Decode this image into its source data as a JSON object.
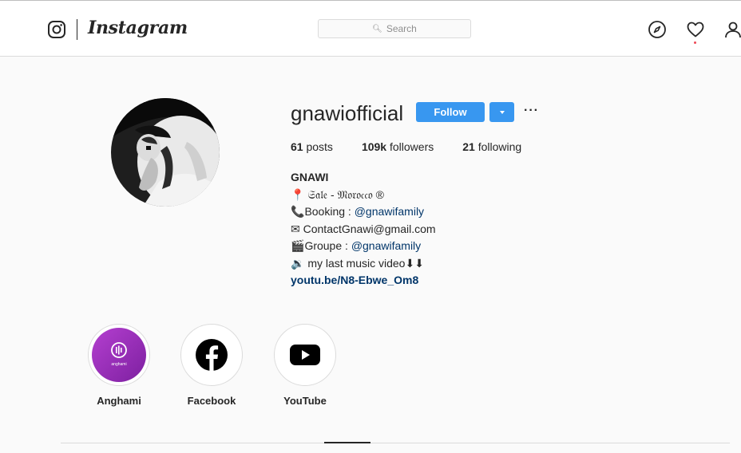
{
  "header": {
    "wordmark": "Instagram",
    "search_placeholder": "Search",
    "icons": [
      "instagram-glyph-icon",
      "compass-icon",
      "heart-icon",
      "profile-icon"
    ]
  },
  "profile": {
    "username": "gnawiofficial",
    "follow_label": "Follow",
    "stats": {
      "posts_count": "61",
      "posts_label": "posts",
      "followers_count": "109k",
      "followers_label": "followers",
      "following_count": "21",
      "following_label": "following"
    },
    "bio": {
      "name": "GNAWI",
      "location_emoji": "📍",
      "location_text": "𝔖𝔞𝔩𝔢 - 𝔐𝔬𝔯𝔬𝔠𝔠𝔬 ®",
      "booking_emoji": "📞",
      "booking_text": "Booking : ",
      "booking_mention": "@gnawifamily",
      "email_emoji": "✉",
      "email_text": "ContactGnawi@gmail.com",
      "groupe_emoji": "🎬",
      "groupe_text": "Groupe : ",
      "groupe_mention": "@gnawifamily",
      "video_emoji": "🔉",
      "video_text": "my last music video⬇⬇",
      "link": "youtu.be/N8-Ebwe_Om8"
    }
  },
  "highlights": [
    {
      "label": "Anghami",
      "inner_text": "anghami",
      "color": "#9b2fb5"
    },
    {
      "label": "Facebook",
      "color": "#000000"
    },
    {
      "label": "YouTube",
      "color": "#000000"
    }
  ],
  "colors": {
    "accent": "#3897f0",
    "link": "#003569"
  }
}
